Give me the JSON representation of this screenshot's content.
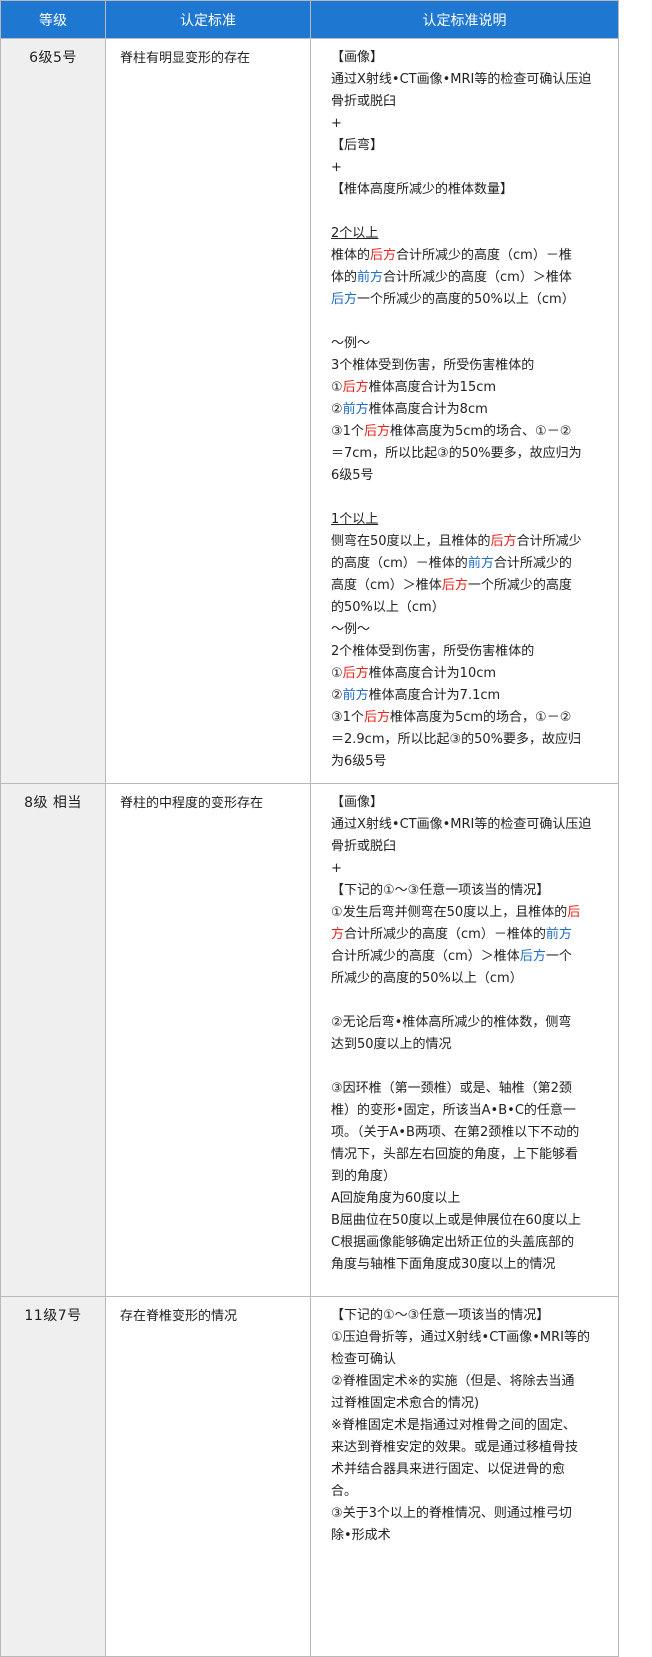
{
  "header": {
    "col_grade": "等级",
    "col_criteria": "认定标准",
    "col_explanation": "认定标准说明"
  },
  "rows": [
    {
      "grade": "6级5号",
      "criteria": "脊柱有明显变形的存在",
      "lines": [
        [
          {
            "t": "【画像】"
          }
        ],
        [
          {
            "t": "通过X射线•CT画像•MRI等的检查可确认压迫"
          }
        ],
        [
          {
            "t": "骨折或脱臼"
          }
        ],
        [
          {
            "t": "+"
          }
        ],
        [
          {
            "t": "【后弯】"
          }
        ],
        [
          {
            "t": "+"
          }
        ],
        [
          {
            "t": "【椎体高度所减少的椎体数量】"
          }
        ],
        [],
        [
          {
            "t": "2个以上",
            "s": "ul"
          }
        ],
        [
          {
            "t": "椎体的"
          },
          {
            "t": "后方",
            "s": "red"
          },
          {
            "t": "合计所减少的高度（cm）－椎"
          }
        ],
        [
          {
            "t": "体的"
          },
          {
            "t": "前方",
            "s": "blue"
          },
          {
            "t": "合计所减少的高度（cm）＞椎体"
          }
        ],
        [
          {
            "t": "后方",
            "s": "blue"
          },
          {
            "t": "一个所减少的高度的50%以上（cm）"
          }
        ],
        [],
        [
          {
            "t": "～例～"
          }
        ],
        [
          {
            "t": "3个椎体受到伤害，所受伤害椎体的"
          }
        ],
        [
          {
            "t": "①"
          },
          {
            "t": "后方",
            "s": "red"
          },
          {
            "t": "椎体高度合计为15cm"
          }
        ],
        [
          {
            "t": "②"
          },
          {
            "t": "前方",
            "s": "blue"
          },
          {
            "t": "椎体高度合计为8cm"
          }
        ],
        [
          {
            "t": "③1个"
          },
          {
            "t": "后方",
            "s": "red"
          },
          {
            "t": "椎体高度为5cm的场合、①－②"
          }
        ],
        [
          {
            "t": "＝7cm，所以比起③的50%要多，故应归为"
          }
        ],
        [
          {
            "t": "6级5号"
          }
        ],
        [],
        [
          {
            "t": "1个以上",
            "s": "ul"
          }
        ],
        [
          {
            "t": "侧弯在50度以上，且椎体的"
          },
          {
            "t": "后方",
            "s": "red"
          },
          {
            "t": "合计所减少"
          }
        ],
        [
          {
            "t": "的高度（cm）－椎体的"
          },
          {
            "t": "前方",
            "s": "blue"
          },
          {
            "t": "合计所减少的"
          }
        ],
        [
          {
            "t": "高度（cm）＞椎体"
          },
          {
            "t": "后方",
            "s": "red"
          },
          {
            "t": "一个所减少的高度"
          }
        ],
        [
          {
            "t": "的50%以上（cm）"
          }
        ],
        [
          {
            "t": "～例～"
          }
        ],
        [
          {
            "t": "2个椎体受到伤害，所受伤害椎体的"
          }
        ],
        [
          {
            "t": "①"
          },
          {
            "t": "后方",
            "s": "red"
          },
          {
            "t": "椎体高度合计为10cm"
          }
        ],
        [
          {
            "t": "②"
          },
          {
            "t": "前方",
            "s": "blue"
          },
          {
            "t": "椎体高度合计为7.1cm"
          }
        ],
        [
          {
            "t": "③1个"
          },
          {
            "t": "后方",
            "s": "red"
          },
          {
            "t": "椎体高度为5cm的场合，①－②"
          }
        ],
        [
          {
            "t": "＝2.9cm，所以比起③的50%要多，故应归"
          }
        ],
        [
          {
            "t": "为6级5号"
          }
        ]
      ]
    },
    {
      "grade": "8级 相当",
      "criteria": "脊柱的中程度的变形存在",
      "lines": [
        [
          {
            "t": "【画像】"
          }
        ],
        [
          {
            "t": "通过X射线•CT画像•MRI等的检查可确认压迫"
          }
        ],
        [
          {
            "t": "骨折或脱臼"
          }
        ],
        [
          {
            "t": "+"
          }
        ],
        [
          {
            "t": "【下记的①～③任意一项该当的情况】"
          }
        ],
        [
          {
            "t": "①发生后弯并侧弯在50度以上，且椎体的"
          },
          {
            "t": "后",
            "s": "red"
          }
        ],
        [
          {
            "t": "方",
            "s": "red"
          },
          {
            "t": "合计所减少的高度（cm）－椎体的"
          },
          {
            "t": "前方",
            "s": "blue"
          }
        ],
        [
          {
            "t": "合计所减少的高度（cm）＞椎体"
          },
          {
            "t": "后方",
            "s": "blue"
          },
          {
            "t": "一个"
          }
        ],
        [
          {
            "t": "所减少的高度的50%以上（cm）"
          }
        ],
        [],
        [
          {
            "t": "②无论后弯•椎体高所减少的椎体数，侧弯"
          }
        ],
        [
          {
            "t": "达到50度以上的情况"
          }
        ],
        [],
        [
          {
            "t": "③因环椎（第一颈椎）或是、轴椎（第2颈"
          }
        ],
        [
          {
            "t": "椎）的变形•固定，所该当A•B•C的任意一"
          }
        ],
        [
          {
            "t": "项。（关于A•B两项、在第2颈椎以下不动的"
          }
        ],
        [
          {
            "t": "情况下，头部左右回旋的角度，上下能够看"
          }
        ],
        [
          {
            "t": "到的角度）"
          }
        ],
        [
          {
            "t": "A回旋角度为60度以上"
          }
        ],
        [
          {
            "t": "B屈曲位在50度以上或是伸展位在60度以上"
          }
        ],
        [
          {
            "t": "C根据画像能够确定出矫正位的头盖底部的"
          }
        ],
        [
          {
            "t": "角度与轴椎下面角度成30度以上的情况"
          }
        ]
      ]
    },
    {
      "grade": "11级7号",
      "criteria": "存在脊椎变形的情况",
      "lines": [
        [
          {
            "t": "【下记的①～③任意一项该当的情况】"
          }
        ],
        [
          {
            "t": "①压迫骨折等，通过X射线•CT画像•MRI等的"
          }
        ],
        [
          {
            "t": "检查可确认"
          }
        ],
        [
          {
            "t": "②脊椎固定术※的实施（但是、将除去当通"
          }
        ],
        [
          {
            "t": "过脊椎固定术愈合的情况)"
          }
        ],
        [
          {
            "t": "※脊椎固定术是指通过对椎骨之间的固定、"
          }
        ],
        [
          {
            "t": "来达到脊椎安定的效果。或是通过移植骨技"
          }
        ],
        [
          {
            "t": "术并结合器具来进行固定、以促进骨的愈"
          }
        ],
        [
          {
            "t": "合。"
          }
        ],
        [
          {
            "t": "③关于3个以上的脊椎情况、则通过椎弓切"
          }
        ],
        [
          {
            "t": "除•形成术"
          }
        ]
      ]
    }
  ]
}
